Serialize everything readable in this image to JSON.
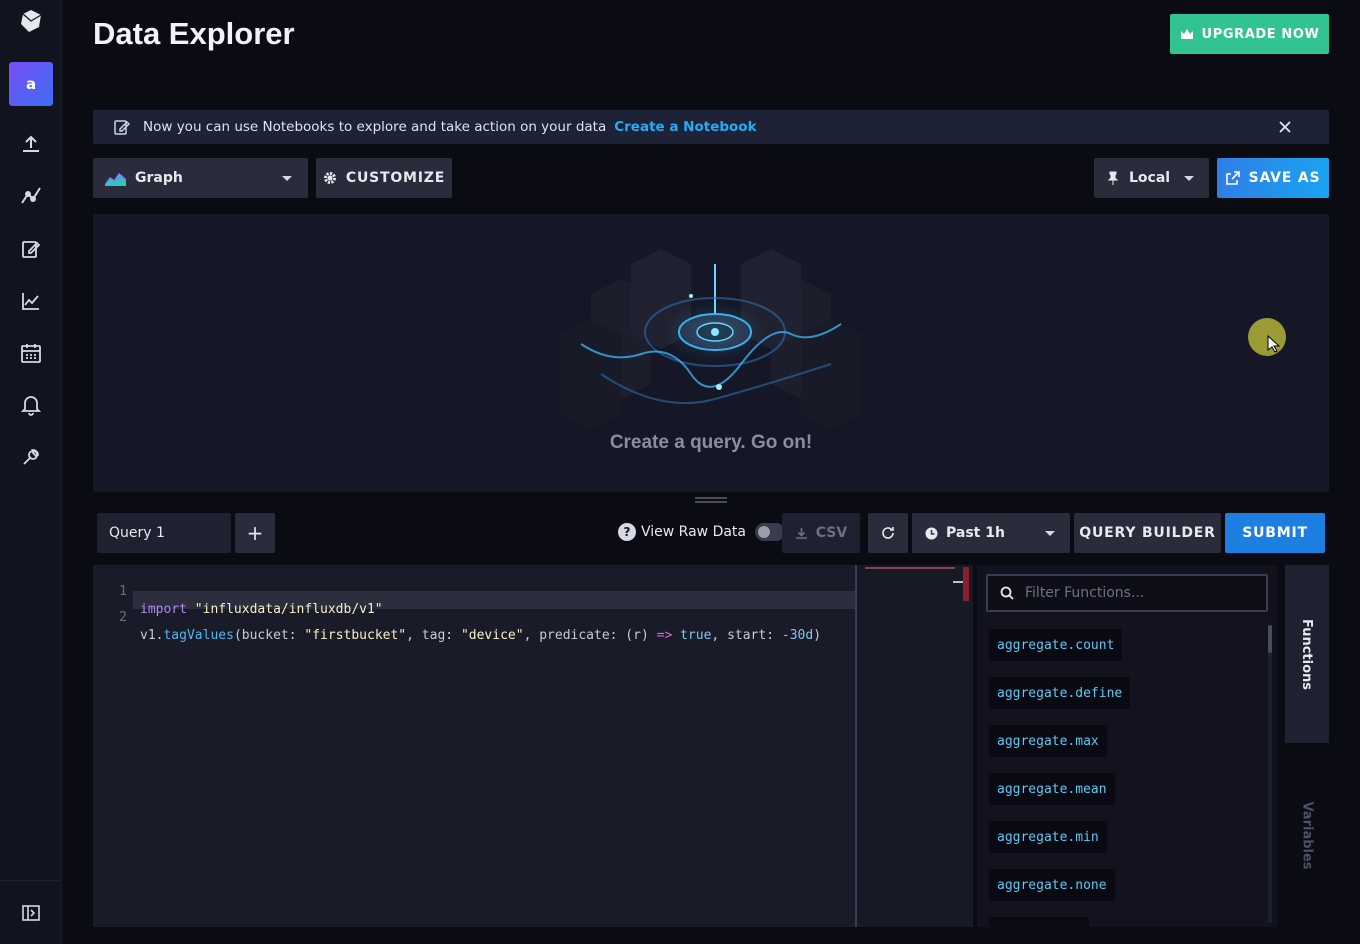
{
  "page": {
    "title": "Data Explorer"
  },
  "sidebar": {
    "avatar_letter": "a",
    "items": [
      {
        "icon": "upload-icon"
      },
      {
        "icon": "pulse-icon"
      },
      {
        "icon": "edit-icon"
      },
      {
        "icon": "chart-icon"
      },
      {
        "icon": "calendar-icon"
      },
      {
        "icon": "bell-icon"
      },
      {
        "icon": "wrench-icon"
      }
    ]
  },
  "header": {
    "upgrade_label": "UPGRADE NOW"
  },
  "banner": {
    "text": "Now you can use Notebooks to explore and take action on your data",
    "link": "Create a Notebook"
  },
  "toolbar": {
    "viz_type": "Graph",
    "customize_label": "CUSTOMIZE",
    "timezone": "Local",
    "save_label": "SAVE AS"
  },
  "viz": {
    "empty_message": "Create a query. Go on!"
  },
  "query_bar": {
    "tab_label": "Query 1",
    "add_label": "+",
    "raw_data_label": "View Raw Data",
    "raw_data_on": false,
    "csv_label": "CSV",
    "range_label": "Past 1h",
    "builder_label": "QUERY BUILDER",
    "submit_label": "SUBMIT"
  },
  "editor": {
    "lines": [
      {
        "num": "1"
      },
      {
        "num": "2"
      }
    ],
    "line1": {
      "kw": "import",
      "str": "\"influxdata/influxdb/v1\""
    },
    "line2": {
      "pre": "v1.",
      "fn": "tagValues",
      "a": "(bucket: ",
      "s1": "\"firstbucket\"",
      "b": ", tag: ",
      "s2": "\"device\"",
      "c": ", predicate: (r) ",
      "op": "=>",
      "d": " ",
      "bool": "true",
      "e": ", start: ",
      "num": "-30d",
      "f": ")"
    }
  },
  "functions": {
    "filter_placeholder": "Filter Functions...",
    "items": [
      "aggregate.count",
      "aggregate.define",
      "aggregate.max",
      "aggregate.mean",
      "aggregate.min",
      "aggregate.none"
    ]
  },
  "side_tabs": {
    "functions": "Functions",
    "variables": "Variables"
  },
  "colors": {
    "accent_green": "#31c490",
    "accent_blue": "#1e7fe3",
    "link": "#22adf6"
  }
}
